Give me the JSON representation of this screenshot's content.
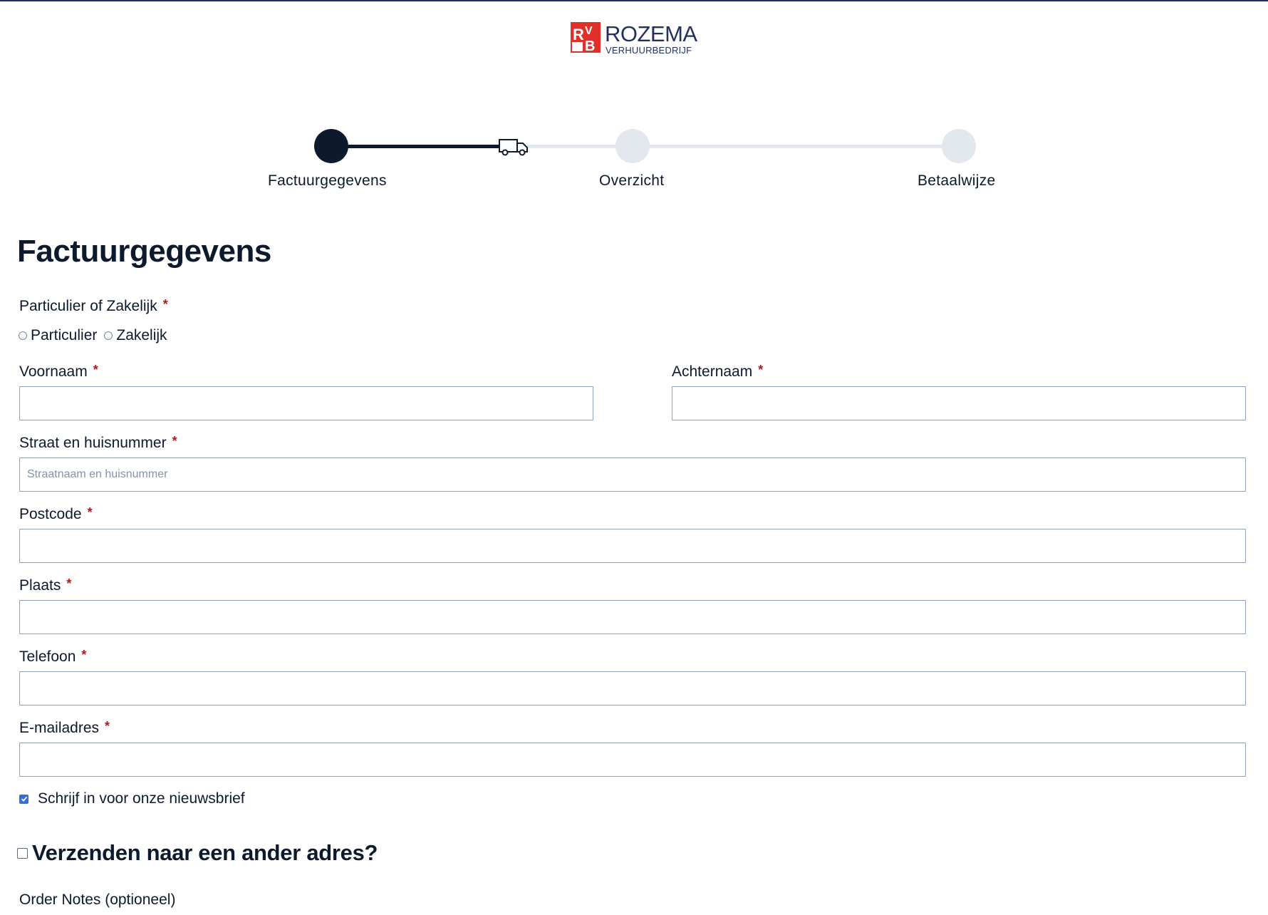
{
  "brand": {
    "name": "ROZEMA",
    "subtitle": "VERHUURBEDRIJF",
    "colors": {
      "red": "#e0302a",
      "navy": "#21325f"
    }
  },
  "stepper": {
    "steps": [
      {
        "label": "Factuurgegevens",
        "state": "active"
      },
      {
        "label": "Overzicht",
        "state": "inactive"
      },
      {
        "label": "Betaalwijze",
        "state": "inactive"
      }
    ],
    "progress_icon": "truck-icon"
  },
  "form": {
    "title": "Factuurgegevens",
    "required_marker": "*",
    "customer_type": {
      "label": "Particulier of Zakelijk",
      "options": [
        {
          "label": "Particulier",
          "selected": false
        },
        {
          "label": "Zakelijk",
          "selected": false
        }
      ]
    },
    "first_name": {
      "label": "Voornaam",
      "value": "",
      "placeholder": ""
    },
    "last_name": {
      "label": "Achternaam",
      "value": "",
      "placeholder": ""
    },
    "street": {
      "label": "Straat en huisnummer",
      "value": "",
      "placeholder": "Straatnaam en huisnummer"
    },
    "postcode": {
      "label": "Postcode",
      "value": "",
      "placeholder": ""
    },
    "city": {
      "label": "Plaats",
      "value": "",
      "placeholder": ""
    },
    "phone": {
      "label": "Telefoon",
      "value": "",
      "placeholder": ""
    },
    "email": {
      "label": "E-mailadres",
      "value": "",
      "placeholder": ""
    },
    "newsletter": {
      "label": "Schrijf in voor onze nieuwsbrief",
      "checked": true
    },
    "ship_different": {
      "label": "Verzenden naar een ander adres?",
      "checked": false
    },
    "order_notes": {
      "label": "Order Notes (optioneel)"
    }
  },
  "theme": {
    "accent": "#0d1a2e",
    "inactive": "#e3e7ee",
    "required": "#b01c1c",
    "checkbox": "#2f6fe0",
    "input_border": "#8ea0c0"
  }
}
